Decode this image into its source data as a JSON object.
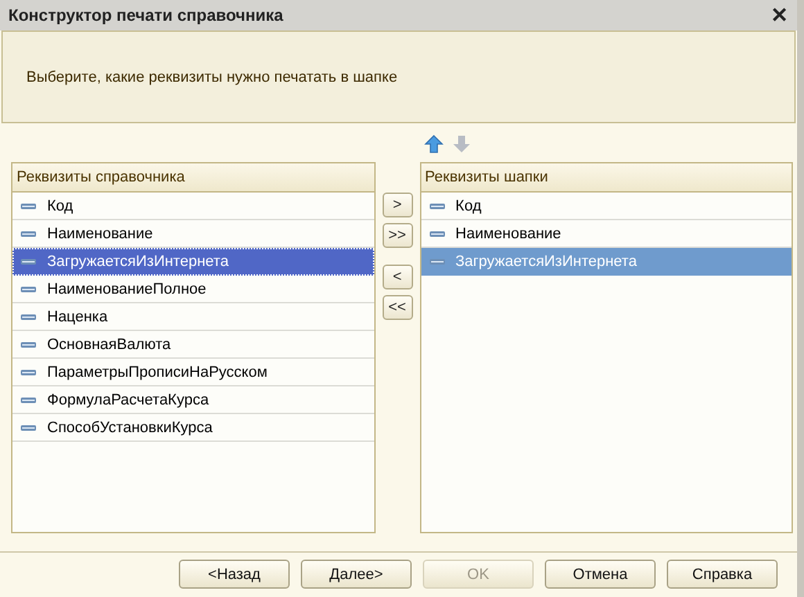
{
  "window": {
    "title": "Конструктор печати справочника",
    "close": "✕"
  },
  "prompt": "Выберите, какие реквизиты нужно печатать в шапке",
  "order_buttons": [
    {
      "kind": "up",
      "disabled": false
    },
    {
      "kind": "down",
      "disabled": true
    }
  ],
  "lists": [
    {
      "title": "Реквизиты справочника",
      "focused": true,
      "items": [
        {
          "label": "Код",
          "selected": false
        },
        {
          "label": "Наименование",
          "selected": false
        },
        {
          "label": "ЗагружаетсяИзИнтернета",
          "selected": true
        },
        {
          "label": "НаименованиеПолное",
          "selected": false
        },
        {
          "label": "Наценка",
          "selected": false
        },
        {
          "label": "ОсновнаяВалюта",
          "selected": false
        },
        {
          "label": "ПараметрыПрописиНаРусском",
          "selected": false
        },
        {
          "label": "ФормулаРасчетаКурса",
          "selected": false
        },
        {
          "label": "СпособУстановкиКурса",
          "selected": false
        }
      ]
    },
    {
      "title": "Реквизиты шапки",
      "focused": false,
      "items": [
        {
          "label": "Код",
          "selected": false
        },
        {
          "label": "Наименование",
          "selected": false
        },
        {
          "label": "ЗагружаетсяИзИнтернета",
          "selected": true
        }
      ]
    }
  ],
  "transfer_buttons": [
    ">",
    ">>",
    "<",
    "<<"
  ],
  "footer_buttons": [
    {
      "label": "<Назад",
      "disabled": false
    },
    {
      "label": "Далее>",
      "disabled": false
    },
    {
      "label": "OK",
      "disabled": true
    },
    {
      "label": "Отмена",
      "disabled": false
    },
    {
      "label": "Справка",
      "disabled": false
    }
  ]
}
